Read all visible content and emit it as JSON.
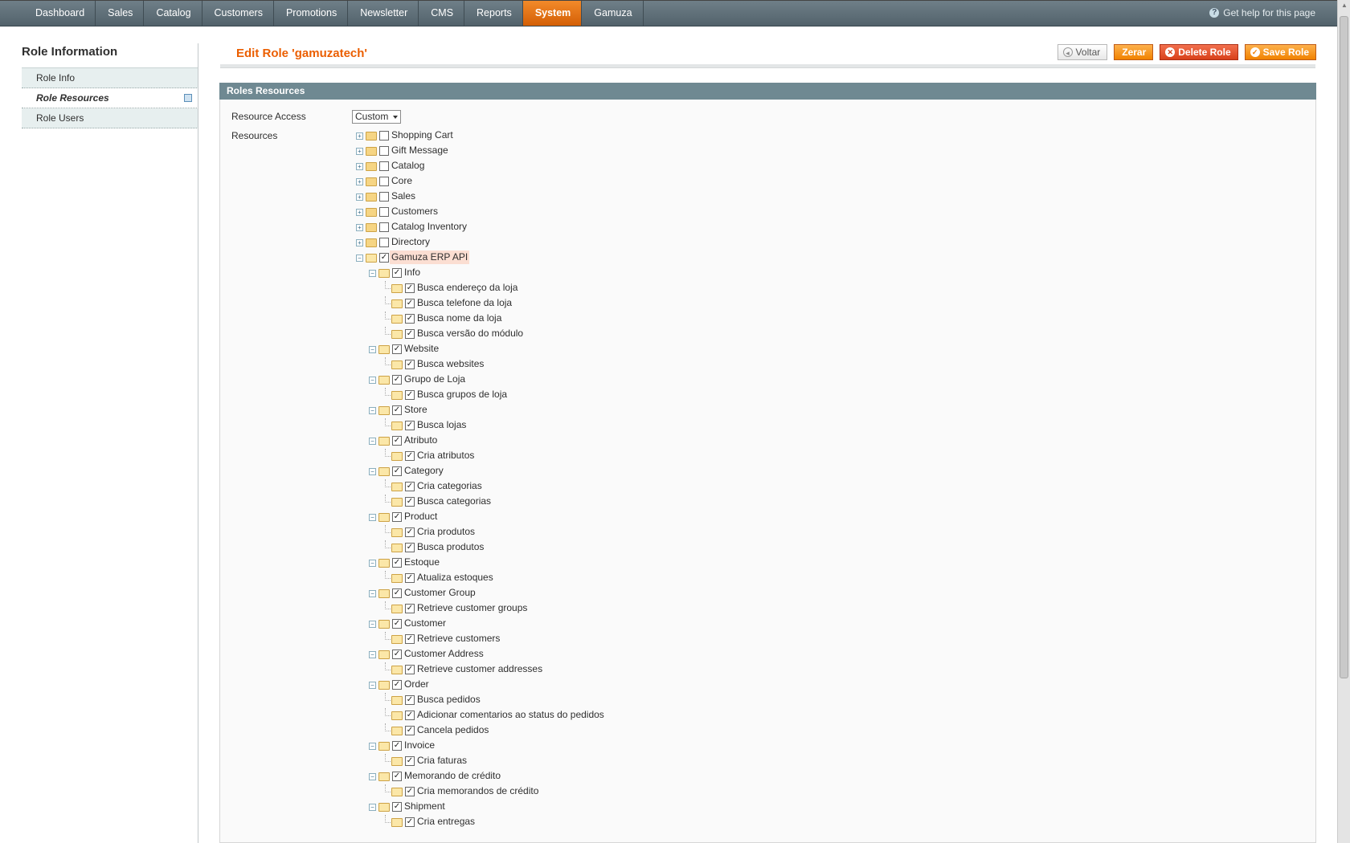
{
  "nav": {
    "items": [
      "Dashboard",
      "Sales",
      "Catalog",
      "Customers",
      "Promotions",
      "Newsletter",
      "CMS",
      "Reports",
      "System",
      "Gamuza"
    ],
    "active": "System",
    "help": "Get help for this page"
  },
  "sidebar": {
    "title": "Role Information",
    "tabs": [
      "Role Info",
      "Role Resources",
      "Role Users"
    ],
    "active": "Role Resources"
  },
  "header": {
    "title": "Edit Role 'gamuzatech'",
    "buttons": {
      "back": "Voltar",
      "reset": "Zerar",
      "delete": "Delete Role",
      "save": "Save Role"
    }
  },
  "section": {
    "title": "Roles Resources",
    "access_label": "Resource Access",
    "access_value": "Custom",
    "resources_label": "Resources"
  },
  "tree": {
    "collapsed": [
      "Shopping Cart",
      "Gift Message",
      "Catalog",
      "Core",
      "Sales",
      "Customers",
      "Catalog Inventory",
      "Directory"
    ],
    "root": "Gamuza ERP API",
    "groups": [
      {
        "label": "Info",
        "children": [
          "Busca endereço da loja",
          "Busca telefone da loja",
          "Busca nome da loja",
          "Busca versão do módulo"
        ]
      },
      {
        "label": "Website",
        "children": [
          "Busca websites"
        ]
      },
      {
        "label": "Grupo de Loja",
        "children": [
          "Busca grupos de loja"
        ]
      },
      {
        "label": "Store",
        "children": [
          "Busca lojas"
        ]
      },
      {
        "label": "Atributo",
        "children": [
          "Cria atributos"
        ]
      },
      {
        "label": "Category",
        "children": [
          "Cria categorias",
          "Busca categorias"
        ]
      },
      {
        "label": "Product",
        "children": [
          "Cria produtos",
          "Busca produtos"
        ]
      },
      {
        "label": "Estoque",
        "children": [
          "Atualiza estoques"
        ]
      },
      {
        "label": "Customer Group",
        "children": [
          "Retrieve customer groups"
        ]
      },
      {
        "label": "Customer",
        "children": [
          "Retrieve customers"
        ]
      },
      {
        "label": "Customer Address",
        "children": [
          "Retrieve customer addresses"
        ]
      },
      {
        "label": "Order",
        "children": [
          "Busca pedidos",
          "Adicionar comentarios ao status do pedidos",
          "Cancela pedidos"
        ]
      },
      {
        "label": "Invoice",
        "children": [
          "Cria faturas"
        ]
      },
      {
        "label": "Memorando de crédito",
        "children": [
          "Cria memorandos de crédito"
        ]
      },
      {
        "label": "Shipment",
        "children": [
          "Cria entregas"
        ]
      }
    ]
  }
}
